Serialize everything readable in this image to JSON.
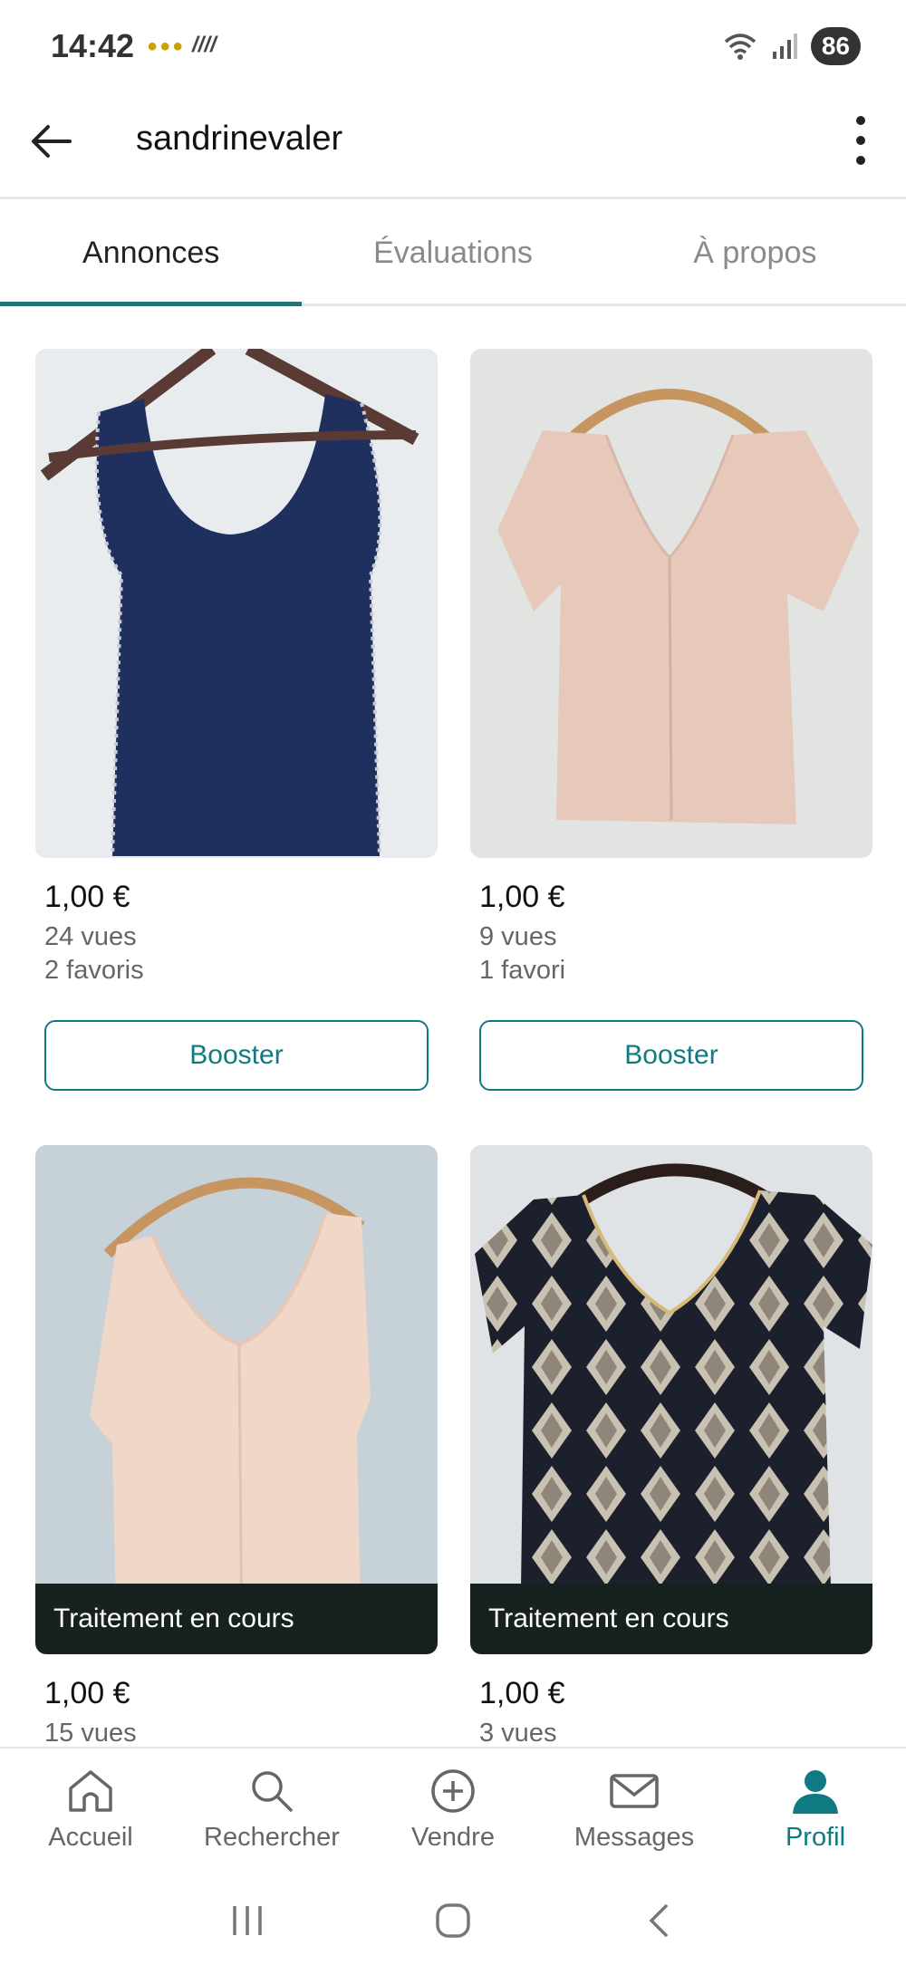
{
  "status": {
    "time": "14:42",
    "battery": "86"
  },
  "header": {
    "username": "sandrinevaler"
  },
  "tabs": [
    {
      "label": "Annonces",
      "active": true
    },
    {
      "label": "Évaluations",
      "active": false
    },
    {
      "label": "À propos",
      "active": false
    }
  ],
  "listings": [
    {
      "price": "1,00 €",
      "views": "24 vues",
      "favorites": "2 favoris",
      "button": "Booster",
      "status": ""
    },
    {
      "price": "1,00 €",
      "views": "9 vues",
      "favorites": "1 favori",
      "button": "Booster",
      "status": ""
    },
    {
      "price": "1,00 €",
      "views": "15 vues",
      "favorites": "",
      "button": "",
      "status": "Traitement en cours"
    },
    {
      "price": "1,00 €",
      "views": "3 vues",
      "favorites": "",
      "button": "",
      "status": "Traitement en cours"
    }
  ],
  "bottom_nav": [
    {
      "label": "Accueil",
      "icon": "home-icon"
    },
    {
      "label": "Rechercher",
      "icon": "search-icon"
    },
    {
      "label": "Vendre",
      "icon": "plus-circle-icon"
    },
    {
      "label": "Messages",
      "icon": "mail-icon"
    },
    {
      "label": "Profil",
      "icon": "profile-icon",
      "active": true
    }
  ],
  "colors": {
    "accent": "#0f7a82",
    "overlay": "#17211f"
  }
}
